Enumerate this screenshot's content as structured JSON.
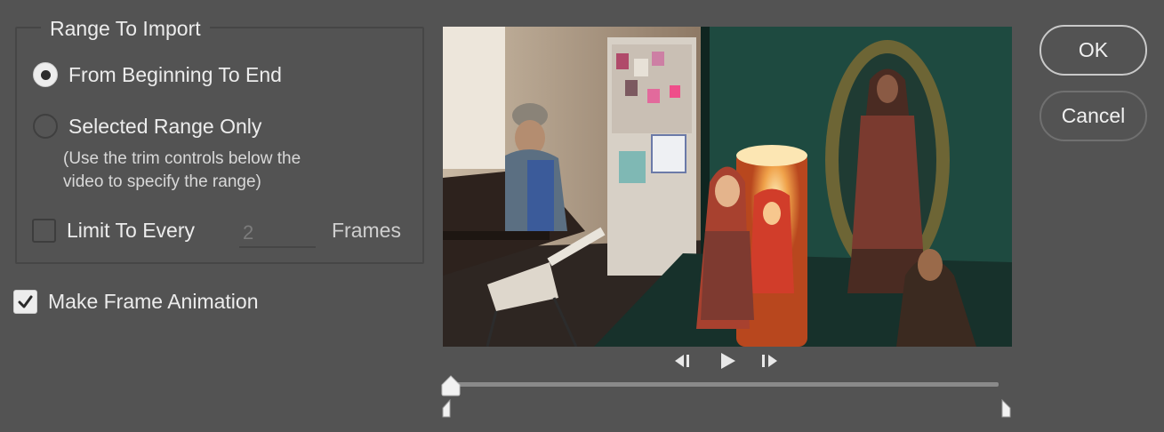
{
  "dialog": {
    "range_group_title": "Range To Import",
    "options": {
      "from_beginning": "From Beginning To End",
      "selected_range": "Selected Range Only",
      "hint_line1": "(Use the trim controls below the",
      "hint_line2": "video to specify the range)"
    },
    "limit": {
      "label": "Limit To Every",
      "value": "2",
      "unit": "Frames",
      "checked": false
    },
    "make_frame_animation": {
      "label": "Make Frame Animation",
      "checked": true
    },
    "selected_option": "from_beginning"
  },
  "buttons": {
    "ok": "OK",
    "cancel": "Cancel"
  },
  "player": {
    "icons": [
      "step-back-icon",
      "play-icon",
      "step-forward-icon"
    ],
    "playhead_fraction": 0,
    "trim_start_fraction": 0,
    "trim_end_fraction": 1
  },
  "colors": {
    "background": "#535353",
    "text": "#ececec",
    "control_fill": "#ededed"
  }
}
